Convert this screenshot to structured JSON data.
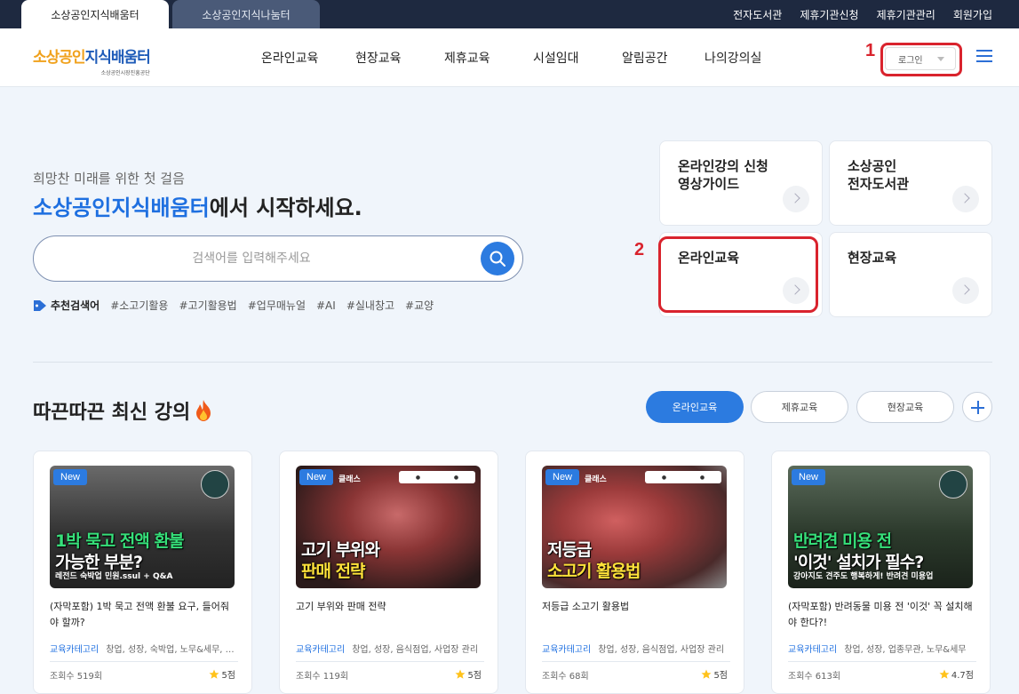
{
  "topbar": {
    "tabs": [
      {
        "label": "소상공인지식배움터",
        "active": true
      },
      {
        "label": "소상공인지식나눔터",
        "active": false
      }
    ],
    "links": [
      "전자도서관",
      "제휴기관신청",
      "제휴기관관리",
      "회원가입"
    ]
  },
  "header": {
    "logo_part1": "소상공인",
    "logo_part2": "지식배움터",
    "logo_sub": "소상공인시장진흥공단",
    "nav": [
      "온라인교육",
      "현장교육",
      "제휴교육",
      "시설임대",
      "알림공간",
      "나의강의실"
    ],
    "login_label": "로그인",
    "annotation_1": "1"
  },
  "hero": {
    "subtitle": "희망찬 미래를 위한 첫 걸음",
    "title_highlight": "소상공인지식배움터",
    "title_rest": "에서 시작하세요.",
    "search_placeholder": "검색어를 입력해주세요",
    "tags_label": "추천검색어",
    "tags": [
      "#소고기활용",
      "#고기활용법",
      "#업무매뉴얼",
      "#AI",
      "#실내창고",
      "#교양"
    ]
  },
  "quick": {
    "items": [
      {
        "line1": "온라인강의 신청",
        "line2": "영상가이드"
      },
      {
        "line1": "소상공인",
        "line2": "전자도서관"
      },
      {
        "line1": "온라인교육",
        "line2": ""
      },
      {
        "line1": "현장교육",
        "line2": ""
      }
    ],
    "annotation_2": "2"
  },
  "latest": {
    "title": "따끈따끈 최신 강의",
    "filters": [
      "온라인교육",
      "제휴교육",
      "현장교육"
    ],
    "cards": [
      {
        "badge": "New",
        "thumb_line1": "1박 묵고 전액 환불",
        "thumb_line2": "가능한 부분?",
        "thumb_line3": "레전드 숙박업 민원.ssul + Q&A",
        "thumb_brand": "",
        "title": "(자막포함) 1박 묵고 전액 환불 요구, 들어줘야 할까?",
        "cat_label": "교육카테고리",
        "cat_value": "창업, 성장, 숙박업, 노무&세무, 기타",
        "views": "조회수 519회",
        "rating": "5점",
        "bg": "#3a3a3a",
        "accent": "#36e07a"
      },
      {
        "badge": "New",
        "thumb_line1": "고기 부위와",
        "thumb_line2": "판매 전략",
        "thumb_line3": "",
        "thumb_brand": "클래스",
        "title": "고기 부위와 판매 전략",
        "cat_label": "교육카테고리",
        "cat_value": "창업, 성장, 음식점업, 사업장 관리",
        "views": "조회수 119회",
        "rating": "5점",
        "bg": "#5a2a2a",
        "accent": "#ffe23a"
      },
      {
        "badge": "New",
        "thumb_line1": "저등급",
        "thumb_line2": "소고기 활용법",
        "thumb_line3": "",
        "thumb_brand": "클래스",
        "title": "저등급 소고기 활용법",
        "cat_label": "교육카테고리",
        "cat_value": "창업, 성장, 음식점업, 사업장 관리",
        "views": "조회수 68회",
        "rating": "5점",
        "bg": "#6b3030",
        "accent": "#ffe23a"
      },
      {
        "badge": "New",
        "thumb_line1": "반려견 미용 전",
        "thumb_line2": "'이것' 설치가 필수?",
        "thumb_line3": "강아지도 견주도 행복하게! 반려견 미용업",
        "thumb_brand": "",
        "title": "(자막포함) 반려동물 미용 전 '이것' 꼭 설치해야 한다?!",
        "cat_label": "교육카테고리",
        "cat_value": "창업, 성장, 업종무관, 노무&세무",
        "views": "조회수 613회",
        "rating": "4.7점",
        "bg": "#2c3a2c",
        "accent": "#ffe23a"
      }
    ]
  }
}
